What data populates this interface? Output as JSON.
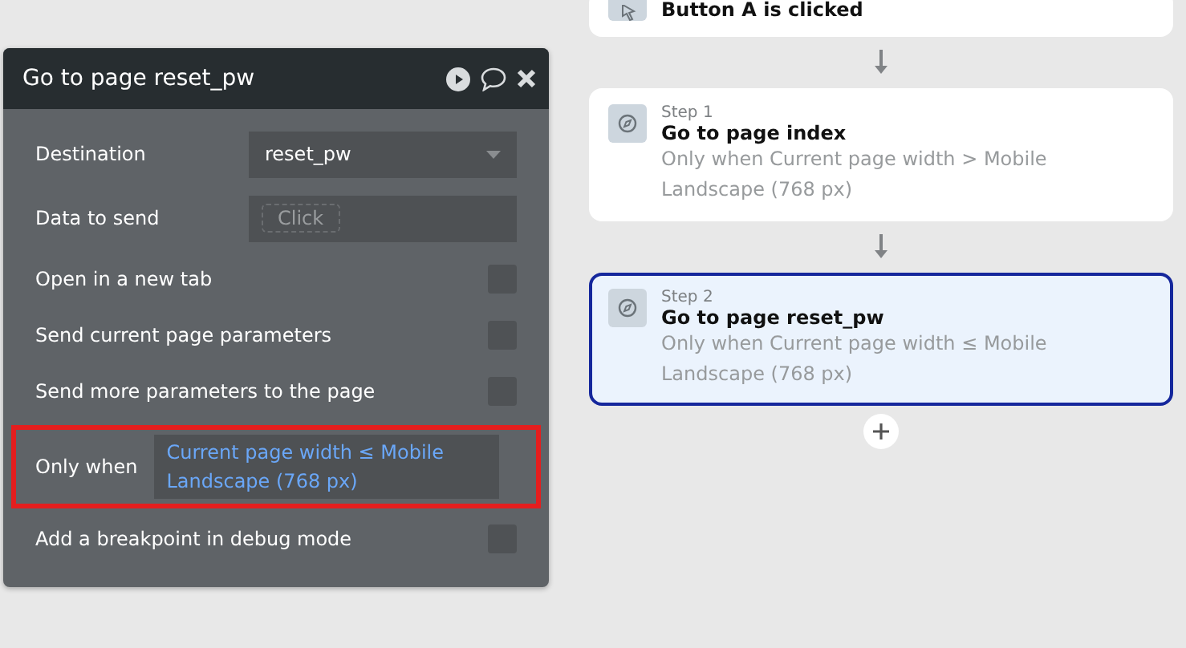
{
  "editor": {
    "title": "Go to page reset_pw",
    "rows": [
      {
        "kind": "dropdown",
        "label": "Destination",
        "value": "reset_pw"
      },
      {
        "kind": "input",
        "label": "Data to send",
        "placeholder": "Click"
      },
      {
        "kind": "checkbox",
        "label": "Open in a new tab",
        "checked": false
      },
      {
        "kind": "checkbox",
        "label": "Send current page parameters",
        "checked": false
      },
      {
        "kind": "checkbox",
        "label": "Send more parameters to the page",
        "checked": false
      },
      {
        "kind": "condition",
        "label": "Only when",
        "value": "Current page width ≤ Mobile Landscape (768 px)",
        "highlighted": true
      },
      {
        "kind": "checkbox",
        "label": "Add a breakpoint in debug mode",
        "checked": false
      }
    ]
  },
  "workflow": {
    "trigger": {
      "title": "Button A is clicked"
    },
    "steps": [
      {
        "step": "Step 1",
        "title": "Go to page index",
        "condition": "Only when Current page width > Mobile Landscape (768 px)",
        "selected": false
      },
      {
        "step": "Step 2",
        "title": "Go to page reset_pw",
        "condition": "Only when Current page width ≤ Mobile Landscape (768 px)",
        "selected": true
      }
    ]
  }
}
